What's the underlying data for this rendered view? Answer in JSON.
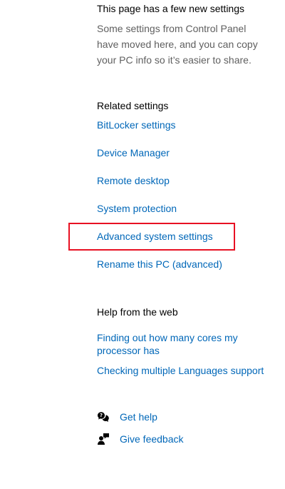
{
  "new_settings": {
    "title": "This page has a few new settings",
    "description": "Some settings from Control Panel have moved here, and you can copy your PC info so it’s easier to share."
  },
  "related_settings": {
    "title": "Related settings",
    "links": [
      "BitLocker settings",
      "Device Manager",
      "Remote desktop",
      "System protection",
      "Advanced system settings",
      "Rename this PC (advanced)"
    ]
  },
  "help_web": {
    "title": "Help from the web",
    "links": [
      "Finding out how many cores my processor has",
      "Checking multiple Languages support"
    ]
  },
  "support": {
    "get_help": "Get help",
    "give_feedback": "Give feedback"
  },
  "colors": {
    "link": "#0067b8",
    "highlight": "#e81123",
    "description": "#5f5f5f"
  },
  "icons": {
    "get_help": "chat-help-icon",
    "give_feedback": "feedback-person-icon"
  }
}
